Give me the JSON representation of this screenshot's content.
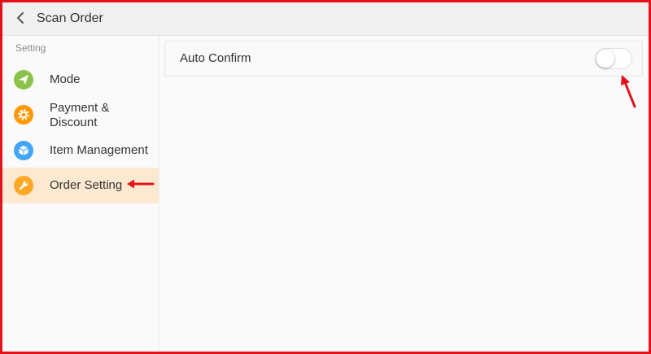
{
  "header": {
    "title": "Scan Order",
    "back_icon": "chevron-left-icon"
  },
  "sidebar": {
    "section_label": "Setting",
    "items": [
      {
        "label": "Mode",
        "icon": "paper-plane-icon",
        "icon_color": "#8bc34a",
        "active": false
      },
      {
        "label_line1": "Payment &",
        "label_line2": "Discount",
        "icon": "gear-icon",
        "icon_color": "#ff9800",
        "active": false
      },
      {
        "label": "Item Management",
        "icon": "box-icon",
        "icon_color": "#42a5f5",
        "active": false
      },
      {
        "label": "Order Setting",
        "icon": "wrench-icon",
        "icon_color": "#ffa726",
        "active": true
      }
    ]
  },
  "main": {
    "settings": [
      {
        "label": "Auto Confirm",
        "toggle_on": false
      }
    ]
  },
  "colors": {
    "frame_border": "#e3131c",
    "active_item_bg": "#fde9cf",
    "annotation_arrow": "#e3131c"
  }
}
